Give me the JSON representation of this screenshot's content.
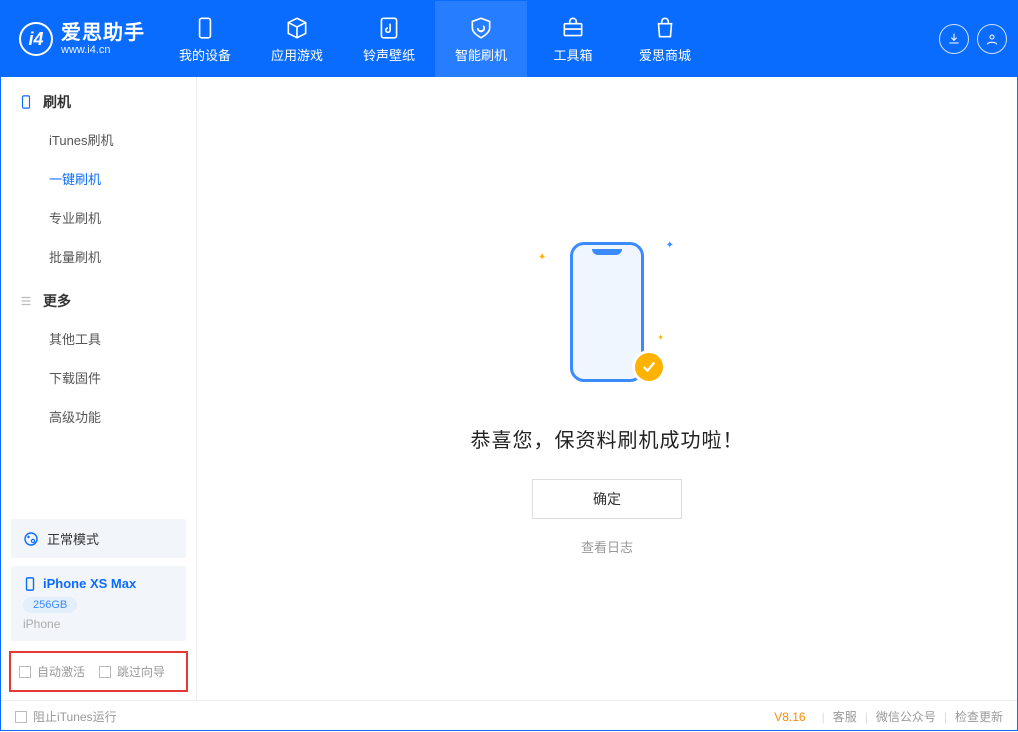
{
  "app": {
    "name_cn": "爱思助手",
    "name_en": "www.i4.cn"
  },
  "header_tabs": [
    {
      "label": "我的设备"
    },
    {
      "label": "应用游戏"
    },
    {
      "label": "铃声壁纸"
    },
    {
      "label": "智能刷机",
      "active": true
    },
    {
      "label": "工具箱"
    },
    {
      "label": "爱思商城"
    }
  ],
  "sidebar": {
    "group1_title": "刷机",
    "group1_items": [
      {
        "label": "iTunes刷机"
      },
      {
        "label": "一键刷机",
        "active": true
      },
      {
        "label": "专业刷机"
      },
      {
        "label": "批量刷机"
      }
    ],
    "group2_title": "更多",
    "group2_items": [
      {
        "label": "其他工具"
      },
      {
        "label": "下载固件"
      },
      {
        "label": "高级功能"
      }
    ],
    "mode_label": "正常模式",
    "device": {
      "name": "iPhone XS Max",
      "capacity": "256GB",
      "type": "iPhone"
    },
    "opt_auto_activate": "自动激活",
    "opt_skip_guide": "跳过向导"
  },
  "main": {
    "success_text": "恭喜您，保资料刷机成功啦！",
    "ok_button": "确定",
    "view_log": "查看日志"
  },
  "footer": {
    "block_itunes": "阻止iTunes运行",
    "version": "V8.16",
    "links": [
      "客服",
      "微信公众号",
      "检查更新"
    ]
  }
}
